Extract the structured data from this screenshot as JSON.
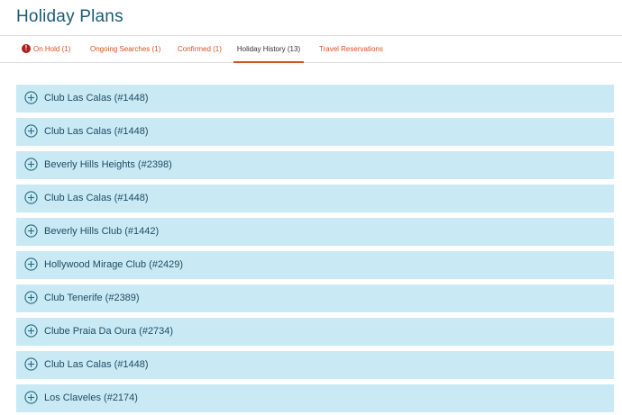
{
  "page": {
    "title": "Holiday Plans"
  },
  "tabs": [
    {
      "label": "On Hold (1)",
      "icon": "alert-icon",
      "active": false
    },
    {
      "label": "Ongoing Searches (1)",
      "active": false
    },
    {
      "label": "Confirmed (1)",
      "active": false
    },
    {
      "label": "Holiday History (13)",
      "active": true
    },
    {
      "label": "Travel Reservations",
      "active": false
    }
  ],
  "history": {
    "items": [
      {
        "label": "Club Las Calas (#1448)"
      },
      {
        "label": "Club Las Calas (#1448)"
      },
      {
        "label": "Beverly Hills Heights (#2398)"
      },
      {
        "label": "Club Las Calas (#1448)"
      },
      {
        "label": "Beverly Hills Club (#1442)"
      },
      {
        "label": "Hollywood Mirage Club (#2429)"
      },
      {
        "label": "Club Tenerife (#2389)"
      },
      {
        "label": "Clube Praia Da Oura (#2734)"
      },
      {
        "label": "Club Las Calas (#1448)"
      },
      {
        "label": "Los Claveles (#2174)"
      }
    ]
  },
  "colors": {
    "title": "#1d5b73",
    "tab_link": "#d9501f",
    "tab_active_text": "#333333",
    "tab_active_underline": "#d9501f",
    "alert_icon": "#b11c1c",
    "row_background": "#c9e9f5",
    "row_text": "#1f4e63",
    "expand_icon": "#2a6e80"
  },
  "icons": {
    "expand": "plus-circle-icon",
    "alert": "exclamation-circle-icon"
  }
}
